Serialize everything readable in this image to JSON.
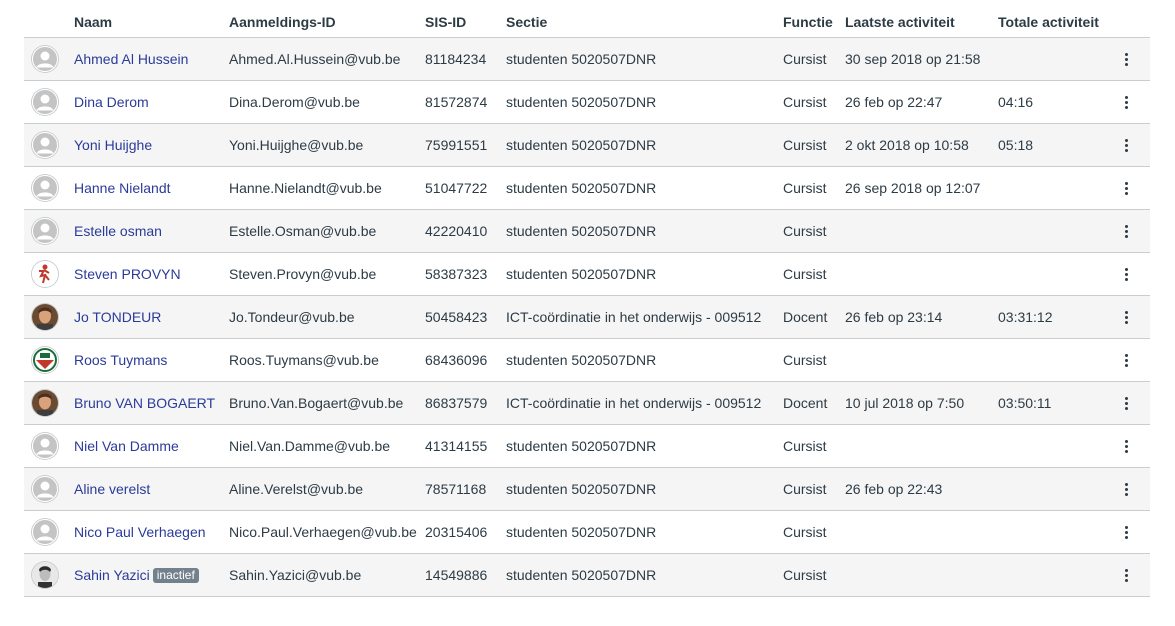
{
  "table": {
    "headers": {
      "name": "Naam",
      "login_id": "Aanmeldings-ID",
      "sis_id": "SIS-ID",
      "section": "Sectie",
      "role": "Functie",
      "last_activity": "Laatste activiteit",
      "total_activity": "Totale activiteit"
    },
    "rows": [
      {
        "name": "Ahmed Al Hussein",
        "login_id": "Ahmed.Al.Hussein@vub.be",
        "sis_id": "81184234",
        "section": "studenten 5020507DNR",
        "role": "Cursist",
        "last_activity": "30 sep 2018 op 21:58",
        "total_activity": "",
        "badge": "",
        "avatar": "default-avatar-icon"
      },
      {
        "name": "Dina Derom",
        "login_id": "Dina.Derom@vub.be",
        "sis_id": "81572874",
        "section": "studenten 5020507DNR",
        "role": "Cursist",
        "last_activity": "26 feb op 22:47",
        "total_activity": "04:16",
        "badge": "",
        "avatar": "default-avatar-icon"
      },
      {
        "name": "Yoni Huijghe",
        "login_id": "Yoni.Huijghe@vub.be",
        "sis_id": "75991551",
        "section": "studenten 5020507DNR",
        "role": "Cursist",
        "last_activity": "2 okt 2018 op 10:58",
        "total_activity": "05:18",
        "badge": "",
        "avatar": "default-avatar-icon"
      },
      {
        "name": "Hanne Nielandt",
        "login_id": "Hanne.Nielandt@vub.be",
        "sis_id": "51047722",
        "section": "studenten 5020507DNR",
        "role": "Cursist",
        "last_activity": "26 sep 2018 op 12:07",
        "total_activity": "",
        "badge": "",
        "avatar": "default-avatar-icon"
      },
      {
        "name": "Estelle osman",
        "login_id": "Estelle.Osman@vub.be",
        "sis_id": "42220410",
        "section": "studenten 5020507DNR",
        "role": "Cursist",
        "last_activity": "",
        "total_activity": "",
        "badge": "",
        "avatar": "default-avatar-icon"
      },
      {
        "name": "Steven PROVYN",
        "login_id": "Steven.Provyn@vub.be",
        "sis_id": "58387323",
        "section": "studenten 5020507DNR",
        "role": "Cursist",
        "last_activity": "",
        "total_activity": "",
        "badge": "",
        "avatar": "runner-avatar-icon"
      },
      {
        "name": "Jo TONDEUR",
        "login_id": "Jo.Tondeur@vub.be",
        "sis_id": "50458423",
        "section": "ICT-coördinatie in het onderwijs - 009512",
        "role": "Docent",
        "last_activity": "26 feb op 23:14",
        "total_activity": "03:31:12",
        "badge": "",
        "avatar": "photo-avatar-icon"
      },
      {
        "name": "Roos Tuymans",
        "login_id": "Roos.Tuymans@vub.be",
        "sis_id": "68436096",
        "section": "studenten 5020507DNR",
        "role": "Cursist",
        "last_activity": "",
        "total_activity": "",
        "badge": "",
        "avatar": "emblem-avatar-icon"
      },
      {
        "name": "Bruno VAN BOGAERT",
        "login_id": "Bruno.Van.Bogaert@vub.be",
        "sis_id": "86837579",
        "section": "ICT-coördinatie in het onderwijs - 009512",
        "role": "Docent",
        "last_activity": "10 jul 2018 op 7:50",
        "total_activity": "03:50:11",
        "badge": "",
        "avatar": "photo-avatar-icon"
      },
      {
        "name": "Niel Van Damme",
        "login_id": "Niel.Van.Damme@vub.be",
        "sis_id": "41314155",
        "section": "studenten 5020507DNR",
        "role": "Cursist",
        "last_activity": "",
        "total_activity": "",
        "badge": "",
        "avatar": "default-avatar-icon"
      },
      {
        "name": "Aline verelst",
        "login_id": "Aline.Verelst@vub.be",
        "sis_id": "78571168",
        "section": "studenten 5020507DNR",
        "role": "Cursist",
        "last_activity": "26 feb op 22:43",
        "total_activity": "",
        "badge": "",
        "avatar": "default-avatar-icon"
      },
      {
        "name": "Nico Paul Verhaegen",
        "login_id": "Nico.Paul.Verhaegen@vub.be",
        "sis_id": "20315406",
        "section": "studenten 5020507DNR",
        "role": "Cursist",
        "last_activity": "",
        "total_activity": "",
        "badge": "",
        "avatar": "default-avatar-icon"
      },
      {
        "name": "Sahin Yazici",
        "login_id": "Sahin.Yazici@vub.be",
        "sis_id": "14549886",
        "section": "studenten 5020507DNR",
        "role": "Cursist",
        "last_activity": "",
        "total_activity": "",
        "badge": "inactief",
        "avatar": "bw-photo-avatar-icon"
      }
    ]
  },
  "colors": {
    "link": "#2b3b9a",
    "text": "#2d3b45",
    "row_alt": "#f5f5f5",
    "border": "#c7cdd1",
    "badge_bg": "#73818c"
  },
  "icons": {
    "row_menu": "kebab-menu-icon"
  }
}
